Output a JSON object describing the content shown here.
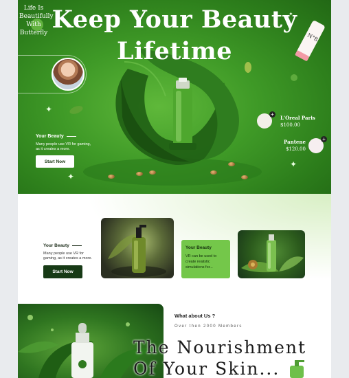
{
  "hero": {
    "title_line1": "Keep Your Beauty",
    "title_line2": "Lifetime",
    "testimonial_text": "Life Is Beautifully With Butterfly",
    "section_heading": "Your Beauty",
    "section_text": "Many people use VR for gaming, as it creates a more.",
    "cta_label": "Start Now",
    "products": [
      {
        "name": "L'Oreal Paris",
        "price": "$100.00"
      },
      {
        "name": "Pantene",
        "price": "$120.00"
      }
    ],
    "tube_label": "N°8"
  },
  "section2": {
    "heading": "Your Beauty",
    "text": "Many people use VR for gaming, as it creates a more.",
    "cta_label": "Start Now",
    "card_heading": "Your Beauty",
    "card_text": "VR can be used to create realistic simulations for..."
  },
  "section3": {
    "heading": "What about Us ?",
    "members": "Over then 2000 Members",
    "title_line1": "The Nourishment",
    "title_line2": "Of Your Skin..."
  },
  "colors": {
    "hero_green": "#3f9a27",
    "dark_green": "#173a16",
    "card_green": "#74c74a"
  }
}
